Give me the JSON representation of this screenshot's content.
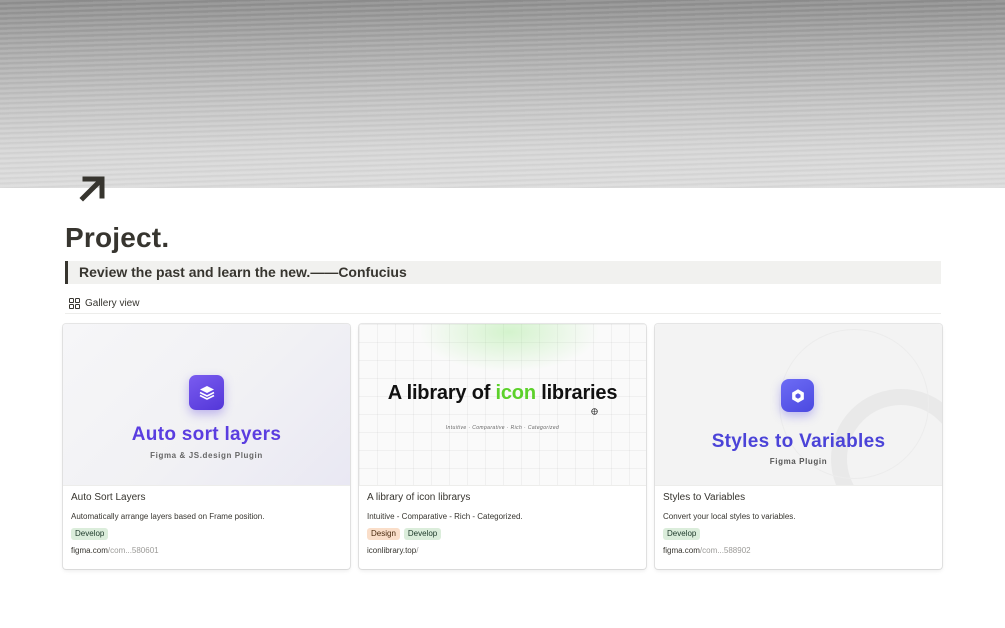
{
  "page": {
    "title": "Project.",
    "icon": "arrow-up-right-icon",
    "quote": "Review the past and learn the new.——Confucius"
  },
  "view": {
    "icon": "gallery-grid-icon",
    "label": "Gallery view"
  },
  "cards": [
    {
      "name": "Auto Sort Layers",
      "description": "Automatically arrange layers based on Frame position.",
      "tags": [
        "Develop"
      ],
      "url_main": "figma.com",
      "url_rest": "/com...580601",
      "preview": {
        "icon": "stacked-layers-icon",
        "title": "Auto sort layers",
        "subtitle": "Figma & JS.design Plugin",
        "accent": "#5a3de0"
      }
    },
    {
      "name": "A library of icon librarys",
      "description": "Intuitive - Comparative - Rich - Categorized.",
      "tags": [
        "Design",
        "Develop"
      ],
      "url_main": "iconlibrary.top",
      "url_rest": "/",
      "preview": {
        "title_before": "A library of ",
        "title_highlight": "icon",
        "title_after": " libraries",
        "subtitle": "Intuitive  ·  Comparative  ·  Rich  ·  Categorized",
        "accent": "#5cd12a"
      }
    },
    {
      "name": "Styles to Variables",
      "description": "Convert your local styles to variables.",
      "tags": [
        "Develop"
      ],
      "url_main": "figma.com",
      "url_rest": "/com...588902",
      "preview": {
        "icon": "hexagon-icon",
        "title": "Styles to Variables",
        "subtitle": "Figma Plugin",
        "accent": "#4b43d8"
      }
    }
  ],
  "colors": {
    "text": "#37352f",
    "quote_bg": "#f1f1ef",
    "tag_develop": "#dbeddb",
    "tag_design": "#fadec9"
  }
}
